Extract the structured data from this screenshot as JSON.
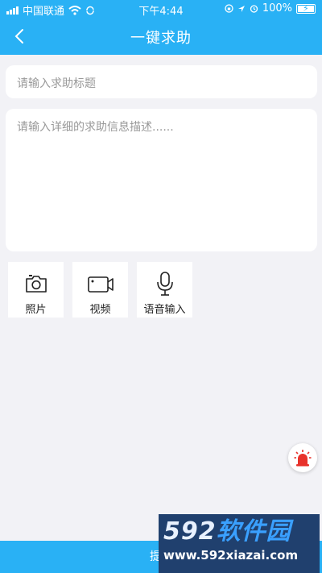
{
  "status_bar": {
    "carrier": "中国联通",
    "time": "下午4:44",
    "battery": "100%"
  },
  "nav": {
    "title": "一键求助"
  },
  "form": {
    "title_placeholder": "请输入求助标题",
    "description_placeholder": "请输入详细的求助信息描述......"
  },
  "media_buttons": [
    {
      "label": "照片",
      "icon": "camera-icon"
    },
    {
      "label": "视频",
      "icon": "video-camera-icon"
    },
    {
      "label": "语音输入",
      "icon": "microphone-icon"
    }
  ],
  "alarm": {
    "icon": "alarm-siren-icon",
    "color": "#e8322b"
  },
  "submit": {
    "label": "提交"
  },
  "watermark": {
    "brand_a": "592",
    "brand_b": "软件园",
    "url": "www.592xiazai.com"
  },
  "colors": {
    "primary": "#29b1f5",
    "background": "#f2f2f6"
  }
}
